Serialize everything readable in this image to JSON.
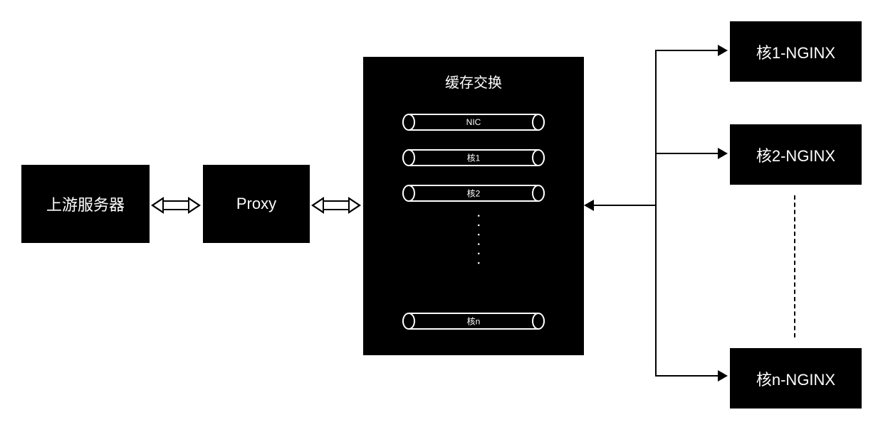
{
  "upstream": {
    "label": "上游服务器"
  },
  "proxy": {
    "label": "Proxy"
  },
  "queue_box": {
    "title": "缓存交换",
    "items": [
      "NIC",
      "核1",
      "核2",
      "核n"
    ]
  },
  "cores": {
    "c1": "核1-NGINX",
    "c2": "核2-NGINX",
    "cn": "核n-NGINX"
  }
}
